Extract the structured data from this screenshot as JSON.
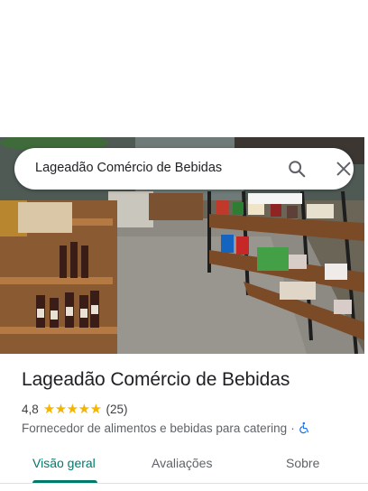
{
  "search": {
    "query": "Lageadão Comércio de Bebidas"
  },
  "place": {
    "name": "Lageadão Comércio de Bebidas",
    "rating": "4,8",
    "stars": "★★★★★",
    "review_count": "(25)",
    "category": "Fornecedor de alimentos e bebidas para catering",
    "separator": "·"
  },
  "tabs": [
    {
      "label": "Visão geral",
      "active": true
    },
    {
      "label": "Avaliações",
      "active": false
    },
    {
      "label": "Sobre",
      "active": false
    }
  ],
  "colors": {
    "accent": "#00796b",
    "star": "#f4b400",
    "accessibility": "#1a73e8"
  },
  "icons": [
    "search-icon",
    "close-icon",
    "wheelchair-icon"
  ]
}
